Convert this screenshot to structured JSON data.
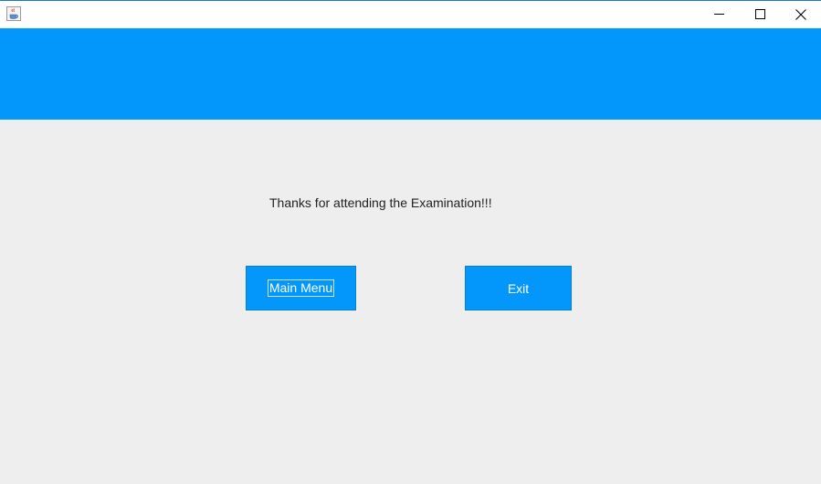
{
  "window": {
    "title": "",
    "icon": "java-coffee-cup-icon",
    "controls": {
      "minimize": "minimize-icon",
      "maximize": "maximize-icon",
      "close": "close-icon"
    }
  },
  "colors": {
    "accent": "#0396fb",
    "background": "#eeeeee",
    "text": "#222222",
    "button_text": "#ffffff"
  },
  "main": {
    "message": "Thanks for attending the Examination!!!",
    "main_menu_label": "Main Menu",
    "exit_label": "Exit"
  }
}
